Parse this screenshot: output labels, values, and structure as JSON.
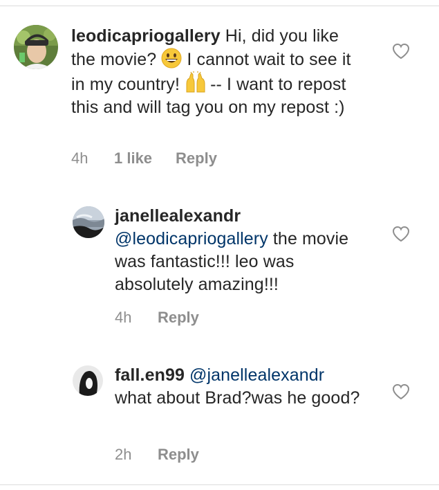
{
  "comments": [
    {
      "username": "leodicapriogallery",
      "text_1": " Hi, did you like the movie? ",
      "emoji_1": "grinning-face-emoji",
      "text_2": " I cannot wait to see it in my country! ",
      "emoji_2": "raising-hands-emoji",
      "text_3": " -- I want to repost this and will tag you on my repost :)",
      "time": "4h",
      "likes": "1 like",
      "reply": "Reply"
    },
    {
      "username": "janellealexandr",
      "mention": "@leodicapriogallery",
      "text": " the movie was fantastic!!! leo was absolutely amazing!!!",
      "time": "4h",
      "reply": "Reply"
    },
    {
      "username": "fall.en99",
      "mention": "@janellealexandr",
      "text": " what about Brad?was he good?",
      "time": "2h",
      "reply": "Reply"
    }
  ],
  "icons": {
    "like": "heart-outline-icon"
  },
  "colors": {
    "text": "#262626",
    "muted": "#8e8e8e",
    "mention": "#003569",
    "divider": "#dbdbdb"
  }
}
